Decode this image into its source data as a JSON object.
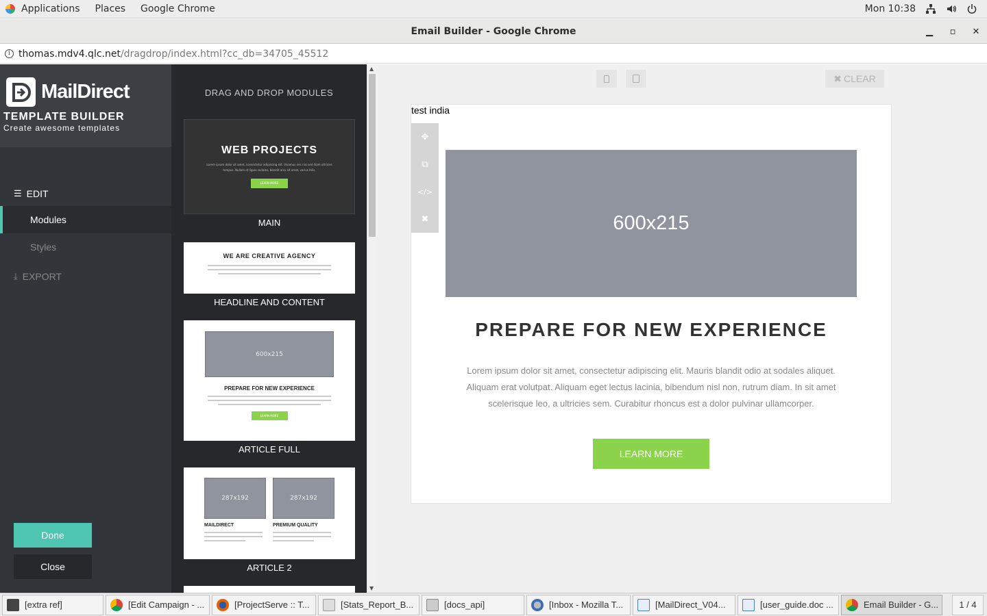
{
  "system": {
    "applications": "Applications",
    "places": "Places",
    "active_app": "Google Chrome",
    "clock": "Mon 10:38"
  },
  "window": {
    "title": "Email Builder - Google Chrome",
    "url_host": "thomas.mdv4.qlc.net",
    "url_path": "/dragdrop/index.html?cc_db=34705_45512"
  },
  "sidebar": {
    "brand_name": "MailDirect",
    "product": "TEMPLATE BUILDER",
    "tagline": "Create awesome templates",
    "edit_label": "EDIT",
    "items": [
      {
        "label": "Modules",
        "active": true
      },
      {
        "label": "Styles",
        "active": false
      }
    ],
    "export_label": "EXPORT",
    "done_label": "Done",
    "close_label": "Close",
    "accent": "#4fc6b1"
  },
  "modules": {
    "header": "DRAG AND DROP MODULES",
    "main": {
      "title": "WEB PROJECTS",
      "text": "Lorem ipsum dolor sit amet, consectetur adipiscing elit. Vivamus nec nisi sed diam ultricies tempus. Nullam et ligula sodales, blandit arcu sit amet, varius felis.",
      "button": "LEARN MORE",
      "caption": "MAIN"
    },
    "headline": {
      "title": "WE ARE CREATIVE AGENCY",
      "caption": "HEADLINE AND CONTENT"
    },
    "article_full": {
      "image": "600x215",
      "title": "PREPARE FOR NEW EXPERIENCE",
      "button": "LEARN MORE",
      "caption": "ARTICLE FULL"
    },
    "article2": {
      "image_left": "287x192",
      "image_right": "287x192",
      "title_left": "MAILDIRECT",
      "title_right": "PREMIUM QUALITY",
      "caption": "ARTICLE 2"
    }
  },
  "canvas": {
    "clear_label": "CLEAR",
    "email_label": "test india",
    "hero_image": "600x215",
    "headline": "PREPARE FOR NEW EXPERIENCE",
    "body": "Lorem ipsum dolor sit amet, consectetur adipiscing elit. Mauris blandit odio at sodales aliquet. Aliquam erat volutpat. Aliquam eget lectus lacinia, bibendum nisl non, rutrum diam. In sit amet scelerisque leo, a ultricies sem. Curabitur rhoncus est a dolor pulvinar ullamcorper.",
    "cta": "LEARN MORE",
    "cta_color": "#8bd34b"
  },
  "taskbar": {
    "tasks": [
      {
        "label": "[extra ref]",
        "icon": "terminal-icon"
      },
      {
        "label": "[Edit Campaign - ...",
        "icon": "chrome-icon"
      },
      {
        "label": "[ProjectServe :: T...",
        "icon": "firefox-icon"
      },
      {
        "label": "[Stats_Report_B...",
        "icon": "text-editor-icon"
      },
      {
        "label": "[docs_api]",
        "icon": "file-manager-icon"
      },
      {
        "label": "[Inbox - Mozilla T...",
        "icon": "thunderbird-icon"
      },
      {
        "label": "[MailDirect_V04...",
        "icon": "document-icon"
      },
      {
        "label": "[user_guide.doc ...",
        "icon": "document-icon"
      },
      {
        "label": "Email Builder - G...",
        "icon": "chrome-icon"
      }
    ],
    "pager": "1 / 4"
  }
}
